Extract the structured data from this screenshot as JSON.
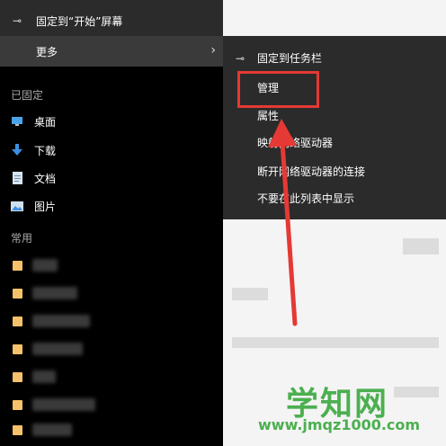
{
  "top_menu": {
    "items": [
      {
        "icon": "pin-icon",
        "label": "固定到“开始”屏幕"
      },
      {
        "icon": "",
        "label": "更多",
        "chevron": "›"
      }
    ]
  },
  "sidebar": {
    "pinned_title": "已固定",
    "pinned": [
      {
        "icon": "desktop-icon",
        "label": "桌面"
      },
      {
        "icon": "download-icon",
        "label": "下载"
      },
      {
        "icon": "document-icon",
        "label": "文档"
      },
      {
        "icon": "picture-icon",
        "label": "图片"
      }
    ],
    "frequent_title": "常用"
  },
  "submenu": {
    "items": [
      {
        "icon": "pin-icon",
        "label": "固定到任务栏"
      },
      {
        "label": "管理"
      },
      {
        "label": "属性"
      },
      {
        "label": "映射网络驱动器"
      },
      {
        "label": "断开网络驱动器的连接"
      },
      {
        "label": "不要在此列表中显示"
      }
    ]
  },
  "annotation": {
    "color": "#e53935"
  },
  "watermark": {
    "main": "学知网",
    "url": "www.jmqz1000.com",
    "color": "#4caf50"
  }
}
